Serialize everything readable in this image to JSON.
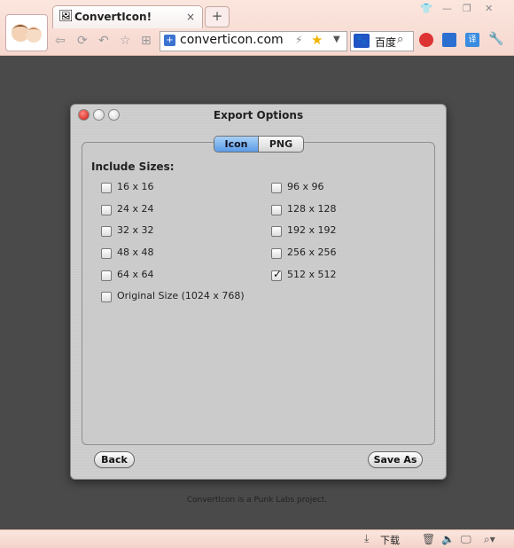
{
  "browser": {
    "tab_title": "ConvertIcon!",
    "tab_close": "×",
    "new_tab": "+",
    "url": "converticon.com",
    "search_text": "百度",
    "status_download": "下载"
  },
  "dialog": {
    "title": "Export Options",
    "tabs": [
      "Icon",
      "PNG"
    ],
    "selected_tab": "Icon",
    "include_label": "Include Sizes:",
    "sizes_left": [
      {
        "label": "16 x 16",
        "checked": false
      },
      {
        "label": "24 x 24",
        "checked": false
      },
      {
        "label": "32 x 32",
        "checked": false
      },
      {
        "label": "48 x 48",
        "checked": false
      },
      {
        "label": "64 x 64",
        "checked": false
      },
      {
        "label": "Original Size (1024 x 768)",
        "checked": false
      }
    ],
    "sizes_right": [
      {
        "label": "96 x 96",
        "checked": false
      },
      {
        "label": "128 x 128",
        "checked": false
      },
      {
        "label": "192 x 192",
        "checked": false
      },
      {
        "label": "256 x 256",
        "checked": false
      },
      {
        "label": "512 x 512",
        "checked": true
      }
    ],
    "back_label": "Back",
    "save_label": "Save As",
    "check_mark": "✓"
  },
  "footer": {
    "text": "ConvertIcon is a Punk Labs project."
  },
  "colors": {
    "page_bg": "#4a4a4a",
    "selected_tab": "#5b9be8",
    "close_button": "#e0443e"
  }
}
